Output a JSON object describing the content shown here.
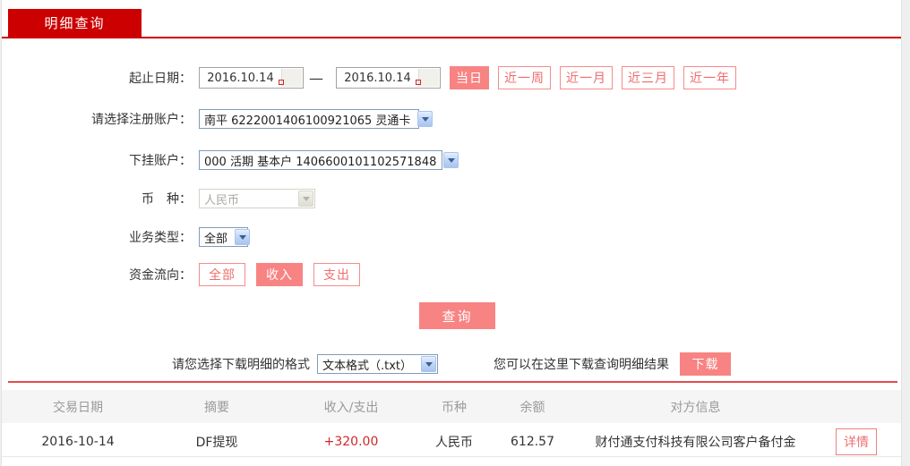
{
  "tab": {
    "label": "明细查询"
  },
  "form": {
    "date_range": {
      "label": "起止日期：",
      "start": "2016.10.14",
      "end": "2016.10.14",
      "separator": "—",
      "quick_buttons": [
        {
          "label": "当日",
          "active": true
        },
        {
          "label": "近一周",
          "active": false
        },
        {
          "label": "近一月",
          "active": false
        },
        {
          "label": "近三月",
          "active": false
        },
        {
          "label": "近一年",
          "active": false
        }
      ]
    },
    "register_account": {
      "label": "请选择注册账户：",
      "value": "南平 6222001406100921065 灵通卡"
    },
    "sub_account": {
      "label": "下挂账户：",
      "value": "000 活期 基本户 1406600101102571848"
    },
    "currency": {
      "label": "币　种：",
      "value": "人民币",
      "disabled": true
    },
    "business_type": {
      "label": "业务类型：",
      "value": "全部"
    },
    "fund_flow": {
      "label": "资金流向：",
      "options": [
        {
          "label": "全部",
          "active": false
        },
        {
          "label": "收入",
          "active": true
        },
        {
          "label": "支出",
          "active": false
        }
      ]
    },
    "query_button": "查询"
  },
  "download": {
    "format_label": "请您选择下载明细的格式",
    "format_value": "文本格式（.txt）",
    "hint": "您可以在这里下载查询明细结果",
    "button": "下载"
  },
  "table": {
    "headers": [
      "交易日期",
      "摘要",
      "收入/支出",
      "币种",
      "余额",
      "对方信息"
    ],
    "rows": [
      {
        "date": "2016-10-14",
        "summary": "DF提现",
        "amount": "+320.00",
        "currency": "人民币",
        "balance": "612.57",
        "counterparty": "财付通支付科技有限公司客户备付金",
        "detail_button": "详情"
      }
    ]
  },
  "icons": {
    "calendar": "calendar-icon",
    "dropdown": "chevron-down-icon"
  },
  "colors": {
    "brand_red": "#cc0000",
    "salmon_fill": "#f88383",
    "salmon_border": "#f58c8c",
    "amount_red": "#d02828",
    "separator_red": "#e34c4c",
    "header_grey": "#f5f5f5",
    "header_text": "#9a9a9a"
  }
}
